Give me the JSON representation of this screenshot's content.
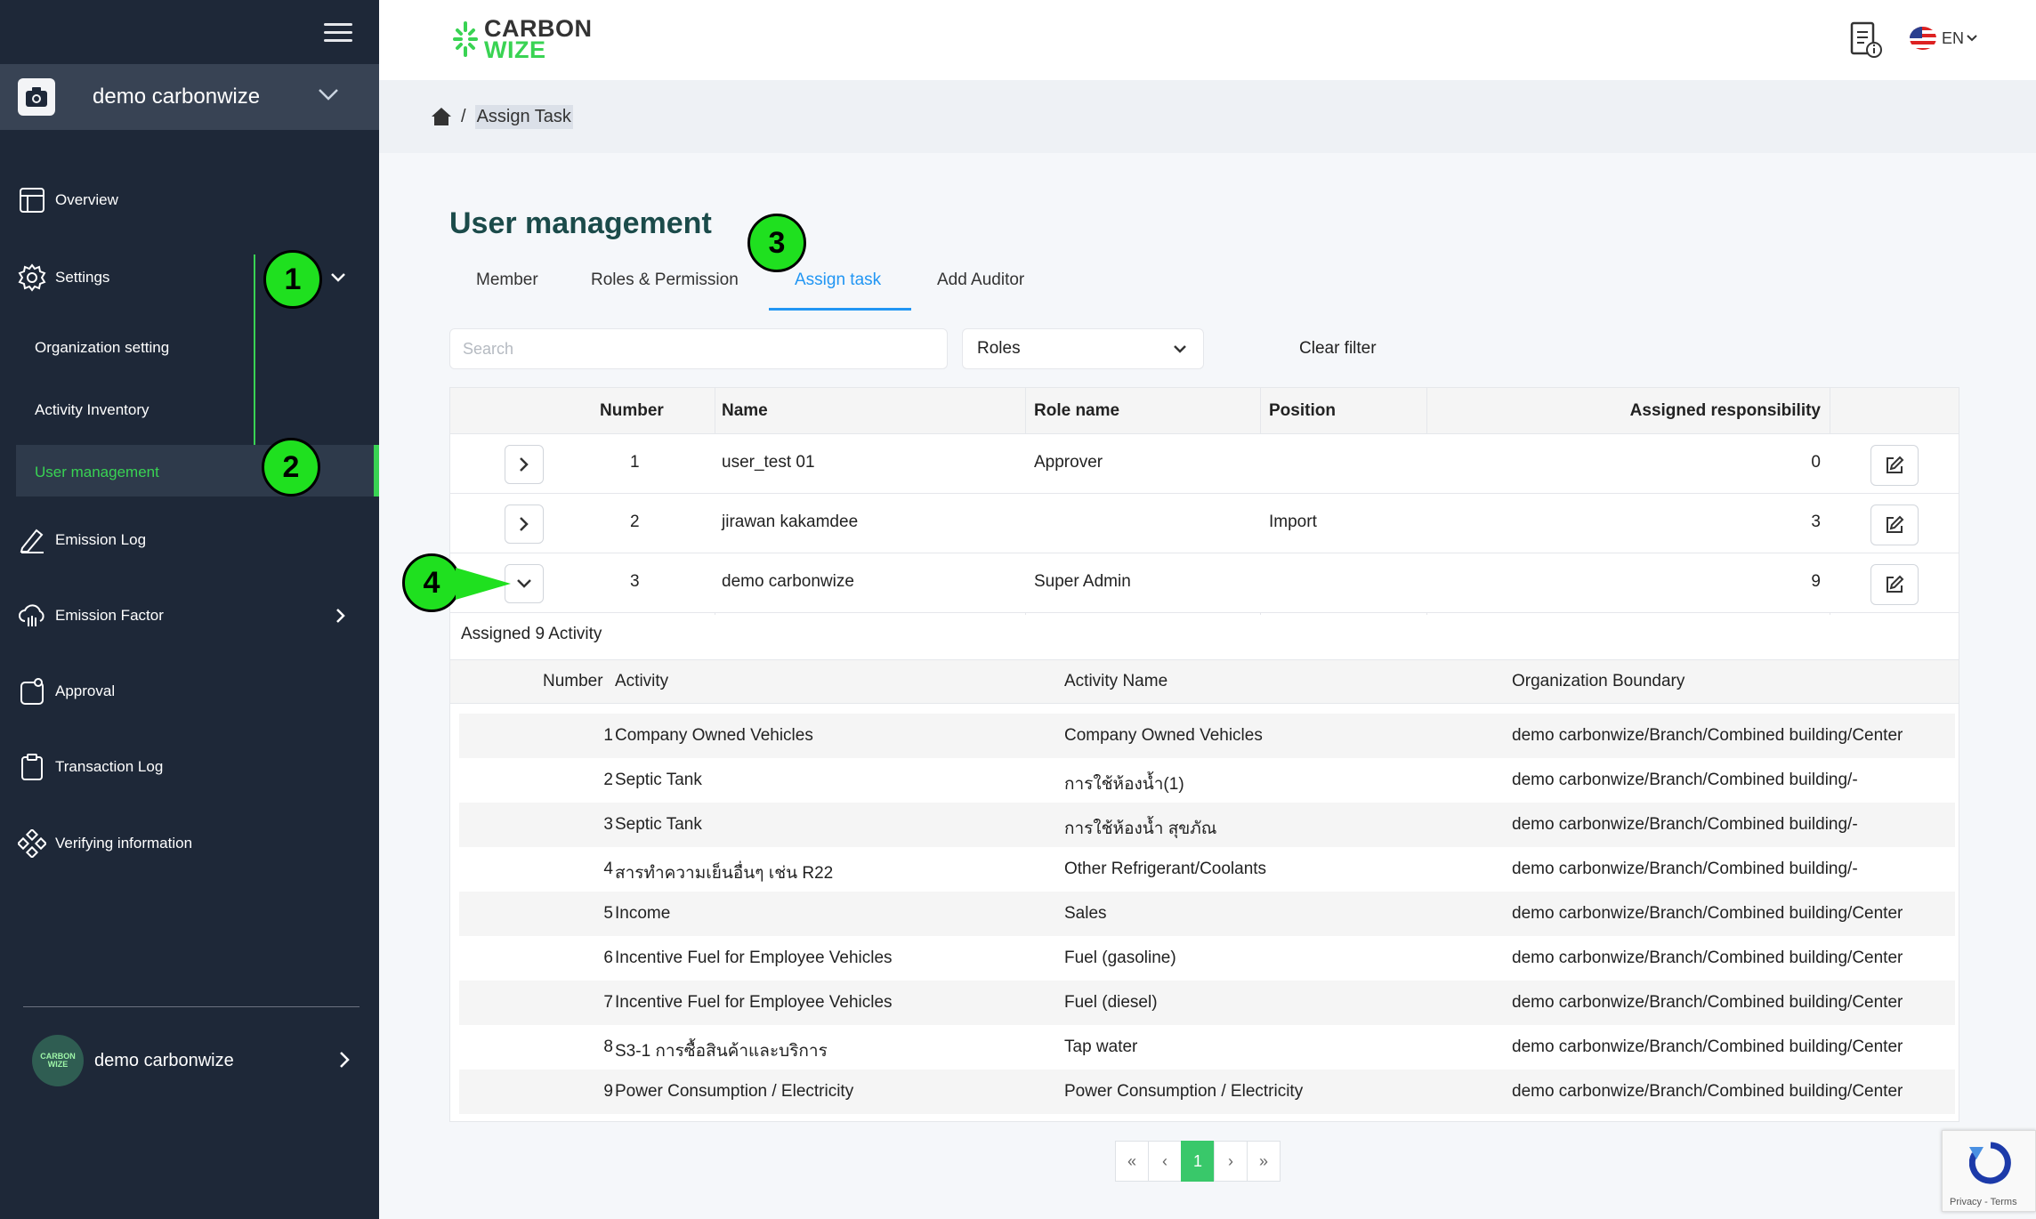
{
  "sidebar": {
    "org_name": "demo carbonwize",
    "items": [
      {
        "label": "Overview",
        "icon": "layout-icon"
      },
      {
        "label": "Settings",
        "icon": "gear-icon"
      },
      {
        "label": "Emission Log",
        "icon": "pen-icon"
      },
      {
        "label": "Emission Factor",
        "icon": "cloud-icon"
      },
      {
        "label": "Approval",
        "icon": "clipboard-icon"
      },
      {
        "label": "Transaction Log",
        "icon": "clipboard-list-icon"
      },
      {
        "label": "Verifying information",
        "icon": "network-icon"
      }
    ],
    "settings_sub": [
      {
        "label": "Organization setting"
      },
      {
        "label": "Activity Inventory"
      },
      {
        "label": "User management"
      }
    ],
    "footer_user": "demo carbonwize",
    "avatar_text": "CARBON WIZE",
    "active_color": "#39d353"
  },
  "markers": [
    "1",
    "2",
    "3",
    "4"
  ],
  "topbar": {
    "logo_line1": "CARBON",
    "logo_line2": "WIZE",
    "language": "EN"
  },
  "breadcrumb": {
    "current": "Assign Task"
  },
  "page": {
    "title": "User management",
    "tabs": [
      {
        "label": "Member"
      },
      {
        "label": "Roles & Permission"
      },
      {
        "label": "Assign task",
        "active": true
      },
      {
        "label": "Add Auditor"
      }
    ],
    "search_placeholder": "Search",
    "roles_select": "Roles",
    "clear_filter": "Clear filter"
  },
  "table": {
    "headers": [
      "Number",
      "Name",
      "Role name",
      "Position",
      "Assigned responsibility"
    ],
    "rows": [
      {
        "number": "1",
        "name": "user_test 01",
        "role": "Approver",
        "position": "",
        "assigned": "0",
        "expanded": false
      },
      {
        "number": "2",
        "name": "jirawan kakamdee",
        "role": "",
        "position": "Import",
        "assigned": "3",
        "expanded": false
      },
      {
        "number": "3",
        "name": "demo carbonwize",
        "role": "Super Admin",
        "position": "",
        "assigned": "9",
        "expanded": true
      }
    ]
  },
  "assigned": {
    "title": "Assigned 9 Activity",
    "headers": [
      "Number",
      "Activity",
      "Activity Name",
      "Organization Boundary"
    ],
    "rows": [
      {
        "number": "1",
        "activity": "Company Owned Vehicles",
        "activity_name": "Company Owned Vehicles",
        "boundary": "demo carbonwize/Branch/Combined building/Center"
      },
      {
        "number": "2",
        "activity": "Septic Tank",
        "activity_name": "การใช้ห้องน้ำ(1)",
        "boundary": "demo carbonwize/Branch/Combined building/-"
      },
      {
        "number": "3",
        "activity": "Septic Tank",
        "activity_name": "การใช้ห้องน้ำ สุขภัณ",
        "boundary": "demo carbonwize/Branch/Combined building/-"
      },
      {
        "number": "4",
        "activity": "สารทำความเย็นอื่นๆ เช่น R22",
        "activity_name": "Other Refrigerant/Coolants",
        "boundary": "demo carbonwize/Branch/Combined building/-"
      },
      {
        "number": "5",
        "activity": "Income",
        "activity_name": "Sales",
        "boundary": "demo carbonwize/Branch/Combined building/Center"
      },
      {
        "number": "6",
        "activity": "Incentive Fuel for Employee Vehicles",
        "activity_name": "Fuel (gasoline)",
        "boundary": "demo carbonwize/Branch/Combined building/Center"
      },
      {
        "number": "7",
        "activity": "Incentive Fuel for Employee Vehicles",
        "activity_name": "Fuel (diesel)",
        "boundary": "demo carbonwize/Branch/Combined building/Center"
      },
      {
        "number": "8",
        "activity": "S3-1 การซื้อสินค้าและบริการ",
        "activity_name": "Tap water",
        "boundary": "demo carbonwize/Branch/Combined building/Center"
      },
      {
        "number": "9",
        "activity": "Power Consumption / Electricity",
        "activity_name": "Power Consumption / Electricity",
        "boundary": "demo carbonwize/Branch/Combined building/Center"
      }
    ]
  },
  "pagination": {
    "first": "«",
    "prev": "‹",
    "current": "1",
    "next": "›",
    "last": "»"
  },
  "recaptcha": {
    "text": "Privacy - Terms"
  }
}
